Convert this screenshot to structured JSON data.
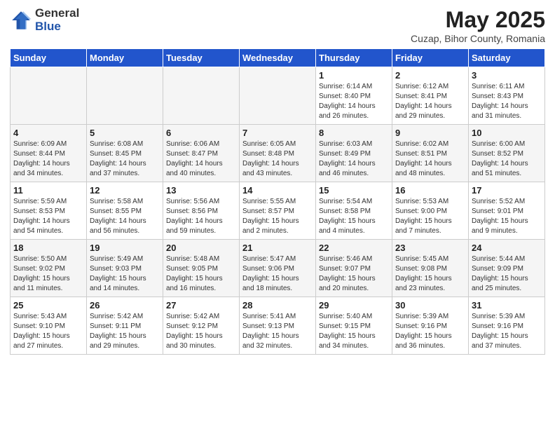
{
  "logo": {
    "general": "General",
    "blue": "Blue"
  },
  "title": "May 2025",
  "location": "Cuzap, Bihor County, Romania",
  "weekdays": [
    "Sunday",
    "Monday",
    "Tuesday",
    "Wednesday",
    "Thursday",
    "Friday",
    "Saturday"
  ],
  "weeks": [
    [
      {
        "day": "",
        "info": ""
      },
      {
        "day": "",
        "info": ""
      },
      {
        "day": "",
        "info": ""
      },
      {
        "day": "",
        "info": ""
      },
      {
        "day": "1",
        "info": "Sunrise: 6:14 AM\nSunset: 8:40 PM\nDaylight: 14 hours and 26 minutes."
      },
      {
        "day": "2",
        "info": "Sunrise: 6:12 AM\nSunset: 8:41 PM\nDaylight: 14 hours and 29 minutes."
      },
      {
        "day": "3",
        "info": "Sunrise: 6:11 AM\nSunset: 8:43 PM\nDaylight: 14 hours and 31 minutes."
      }
    ],
    [
      {
        "day": "4",
        "info": "Sunrise: 6:09 AM\nSunset: 8:44 PM\nDaylight: 14 hours and 34 minutes."
      },
      {
        "day": "5",
        "info": "Sunrise: 6:08 AM\nSunset: 8:45 PM\nDaylight: 14 hours and 37 minutes."
      },
      {
        "day": "6",
        "info": "Sunrise: 6:06 AM\nSunset: 8:47 PM\nDaylight: 14 hours and 40 minutes."
      },
      {
        "day": "7",
        "info": "Sunrise: 6:05 AM\nSunset: 8:48 PM\nDaylight: 14 hours and 43 minutes."
      },
      {
        "day": "8",
        "info": "Sunrise: 6:03 AM\nSunset: 8:49 PM\nDaylight: 14 hours and 46 minutes."
      },
      {
        "day": "9",
        "info": "Sunrise: 6:02 AM\nSunset: 8:51 PM\nDaylight: 14 hours and 48 minutes."
      },
      {
        "day": "10",
        "info": "Sunrise: 6:00 AM\nSunset: 8:52 PM\nDaylight: 14 hours and 51 minutes."
      }
    ],
    [
      {
        "day": "11",
        "info": "Sunrise: 5:59 AM\nSunset: 8:53 PM\nDaylight: 14 hours and 54 minutes."
      },
      {
        "day": "12",
        "info": "Sunrise: 5:58 AM\nSunset: 8:55 PM\nDaylight: 14 hours and 56 minutes."
      },
      {
        "day": "13",
        "info": "Sunrise: 5:56 AM\nSunset: 8:56 PM\nDaylight: 14 hours and 59 minutes."
      },
      {
        "day": "14",
        "info": "Sunrise: 5:55 AM\nSunset: 8:57 PM\nDaylight: 15 hours and 2 minutes."
      },
      {
        "day": "15",
        "info": "Sunrise: 5:54 AM\nSunset: 8:58 PM\nDaylight: 15 hours and 4 minutes."
      },
      {
        "day": "16",
        "info": "Sunrise: 5:53 AM\nSunset: 9:00 PM\nDaylight: 15 hours and 7 minutes."
      },
      {
        "day": "17",
        "info": "Sunrise: 5:52 AM\nSunset: 9:01 PM\nDaylight: 15 hours and 9 minutes."
      }
    ],
    [
      {
        "day": "18",
        "info": "Sunrise: 5:50 AM\nSunset: 9:02 PM\nDaylight: 15 hours and 11 minutes."
      },
      {
        "day": "19",
        "info": "Sunrise: 5:49 AM\nSunset: 9:03 PM\nDaylight: 15 hours and 14 minutes."
      },
      {
        "day": "20",
        "info": "Sunrise: 5:48 AM\nSunset: 9:05 PM\nDaylight: 15 hours and 16 minutes."
      },
      {
        "day": "21",
        "info": "Sunrise: 5:47 AM\nSunset: 9:06 PM\nDaylight: 15 hours and 18 minutes."
      },
      {
        "day": "22",
        "info": "Sunrise: 5:46 AM\nSunset: 9:07 PM\nDaylight: 15 hours and 20 minutes."
      },
      {
        "day": "23",
        "info": "Sunrise: 5:45 AM\nSunset: 9:08 PM\nDaylight: 15 hours and 23 minutes."
      },
      {
        "day": "24",
        "info": "Sunrise: 5:44 AM\nSunset: 9:09 PM\nDaylight: 15 hours and 25 minutes."
      }
    ],
    [
      {
        "day": "25",
        "info": "Sunrise: 5:43 AM\nSunset: 9:10 PM\nDaylight: 15 hours and 27 minutes."
      },
      {
        "day": "26",
        "info": "Sunrise: 5:42 AM\nSunset: 9:11 PM\nDaylight: 15 hours and 29 minutes."
      },
      {
        "day": "27",
        "info": "Sunrise: 5:42 AM\nSunset: 9:12 PM\nDaylight: 15 hours and 30 minutes."
      },
      {
        "day": "28",
        "info": "Sunrise: 5:41 AM\nSunset: 9:13 PM\nDaylight: 15 hours and 32 minutes."
      },
      {
        "day": "29",
        "info": "Sunrise: 5:40 AM\nSunset: 9:15 PM\nDaylight: 15 hours and 34 minutes."
      },
      {
        "day": "30",
        "info": "Sunrise: 5:39 AM\nSunset: 9:16 PM\nDaylight: 15 hours and 36 minutes."
      },
      {
        "day": "31",
        "info": "Sunrise: 5:39 AM\nSunset: 9:16 PM\nDaylight: 15 hours and 37 minutes."
      }
    ]
  ]
}
